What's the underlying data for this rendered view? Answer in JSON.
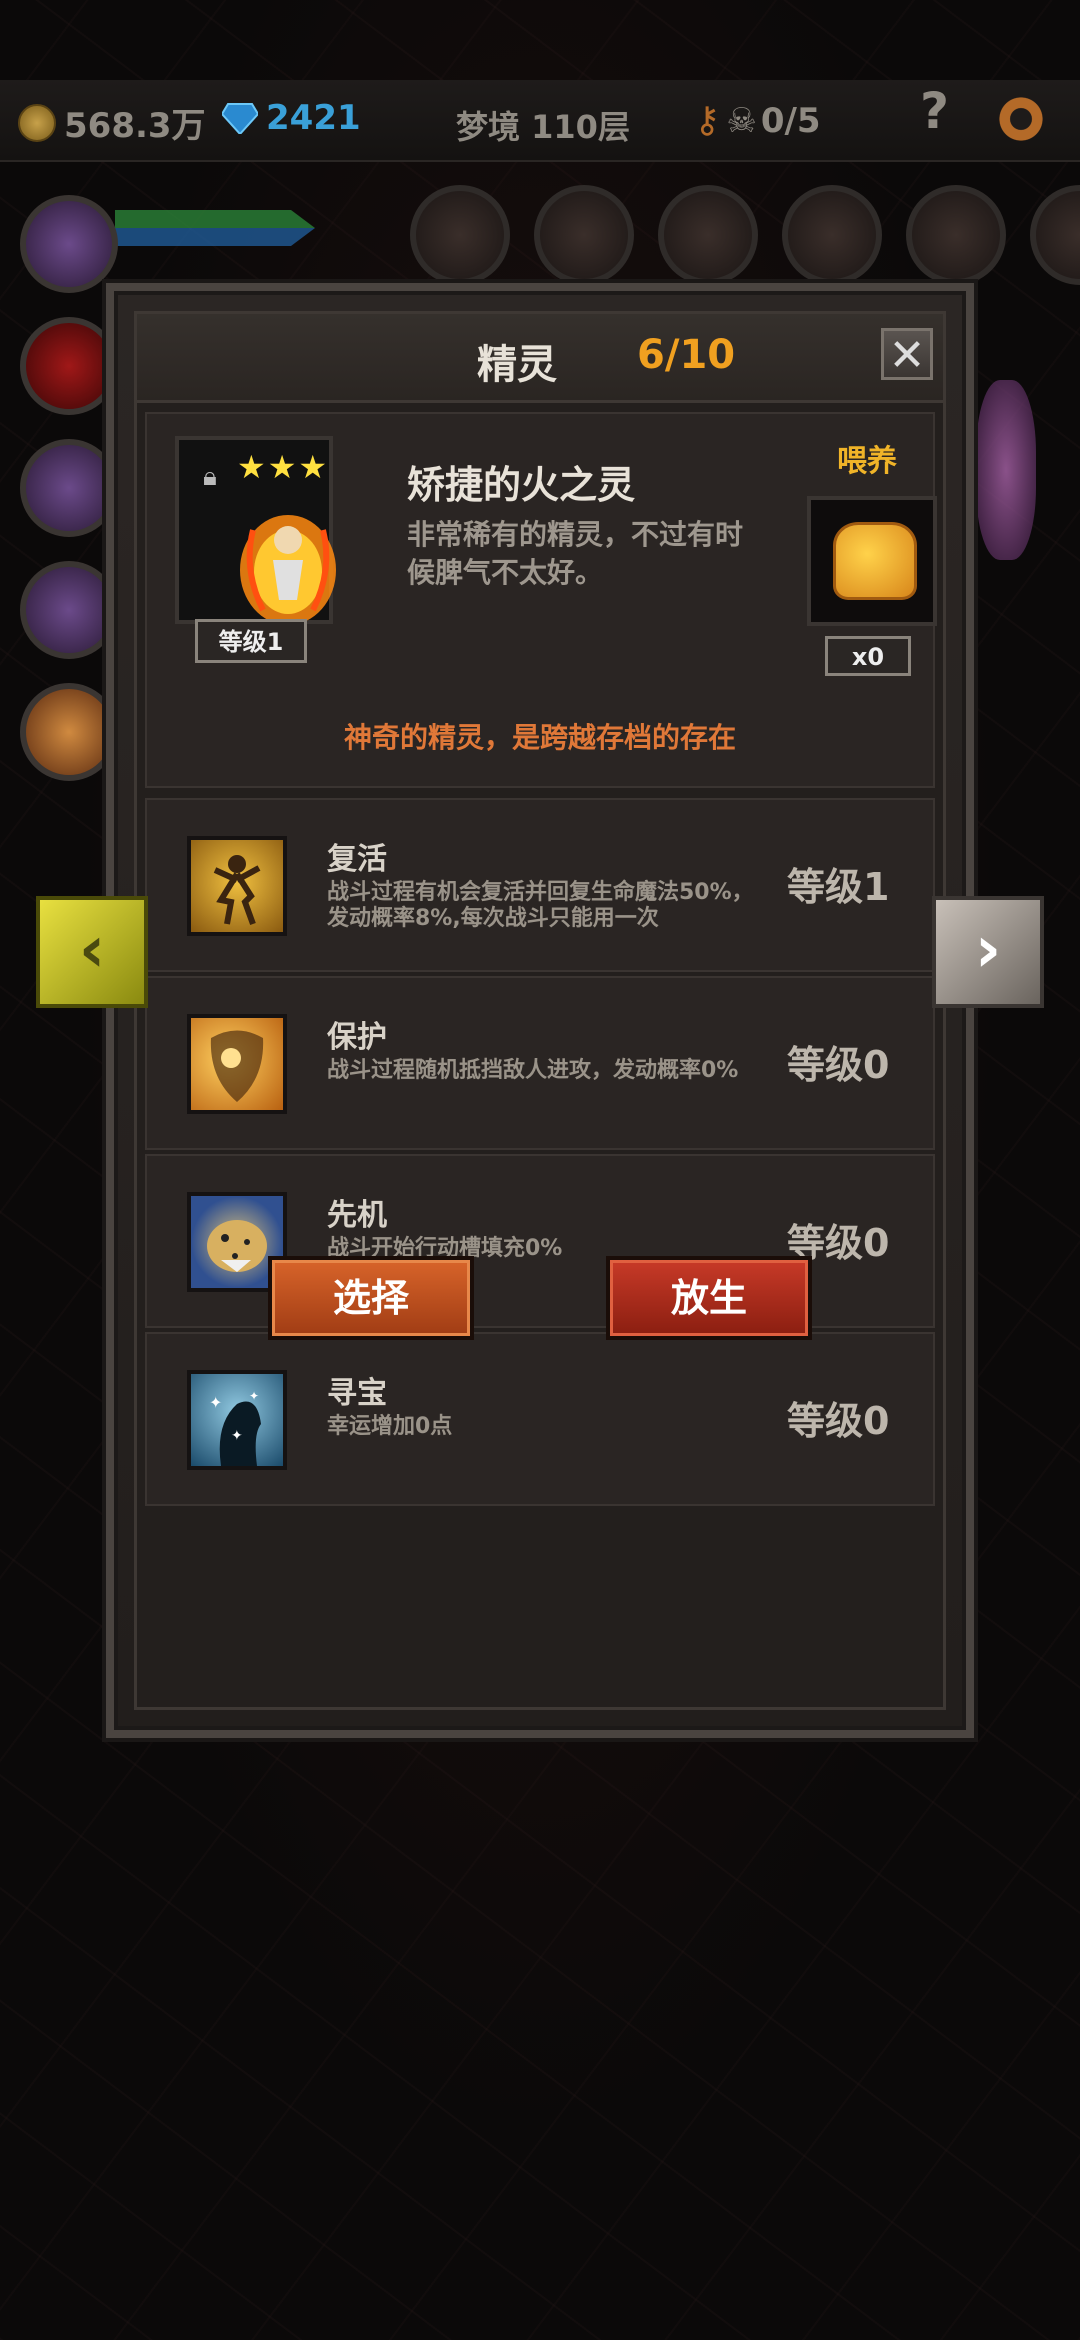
{
  "topbar": {
    "gold": "568.3万",
    "gems": "2421",
    "floor": "梦境 110层",
    "keys": "0/5",
    "help": "?"
  },
  "panel": {
    "title": "精灵",
    "count": "6/10",
    "close": "✕"
  },
  "spirit": {
    "stars": "★★★",
    "level": "等级1",
    "name": "矫捷的火之灵",
    "description": "非常稀有的精灵，不过有时候脾气不太好。",
    "feed_label": "喂养",
    "feed_count": "x0",
    "tagline": "神奇的精灵，是跨越存档的存在"
  },
  "skills": [
    {
      "name": "复活",
      "desc": "战斗过程有机会复活并回复生命魔法50%，发动概率8%,每次战斗只能用一次",
      "level": "等级1",
      "icon": "revive-icon"
    },
    {
      "name": "保护",
      "desc": "战斗过程随机抵挡敌人进攻，发动概率0%",
      "level": "等级0",
      "icon": "protect-icon"
    },
    {
      "name": "先机",
      "desc": "战斗开始行动槽填充0%",
      "level": "等级0",
      "icon": "leopard-icon"
    },
    {
      "name": "寻宝",
      "desc": "幸运增加0点",
      "level": "等级0",
      "icon": "treasure-icon"
    }
  ],
  "buttons": {
    "select": "选择",
    "release": "放生"
  },
  "nav": {
    "prev": "‹",
    "next": "›"
  },
  "colors": {
    "accent_orange": "#f0a020",
    "tagline": "#e07838",
    "gem_blue": "#3aa0d8"
  }
}
